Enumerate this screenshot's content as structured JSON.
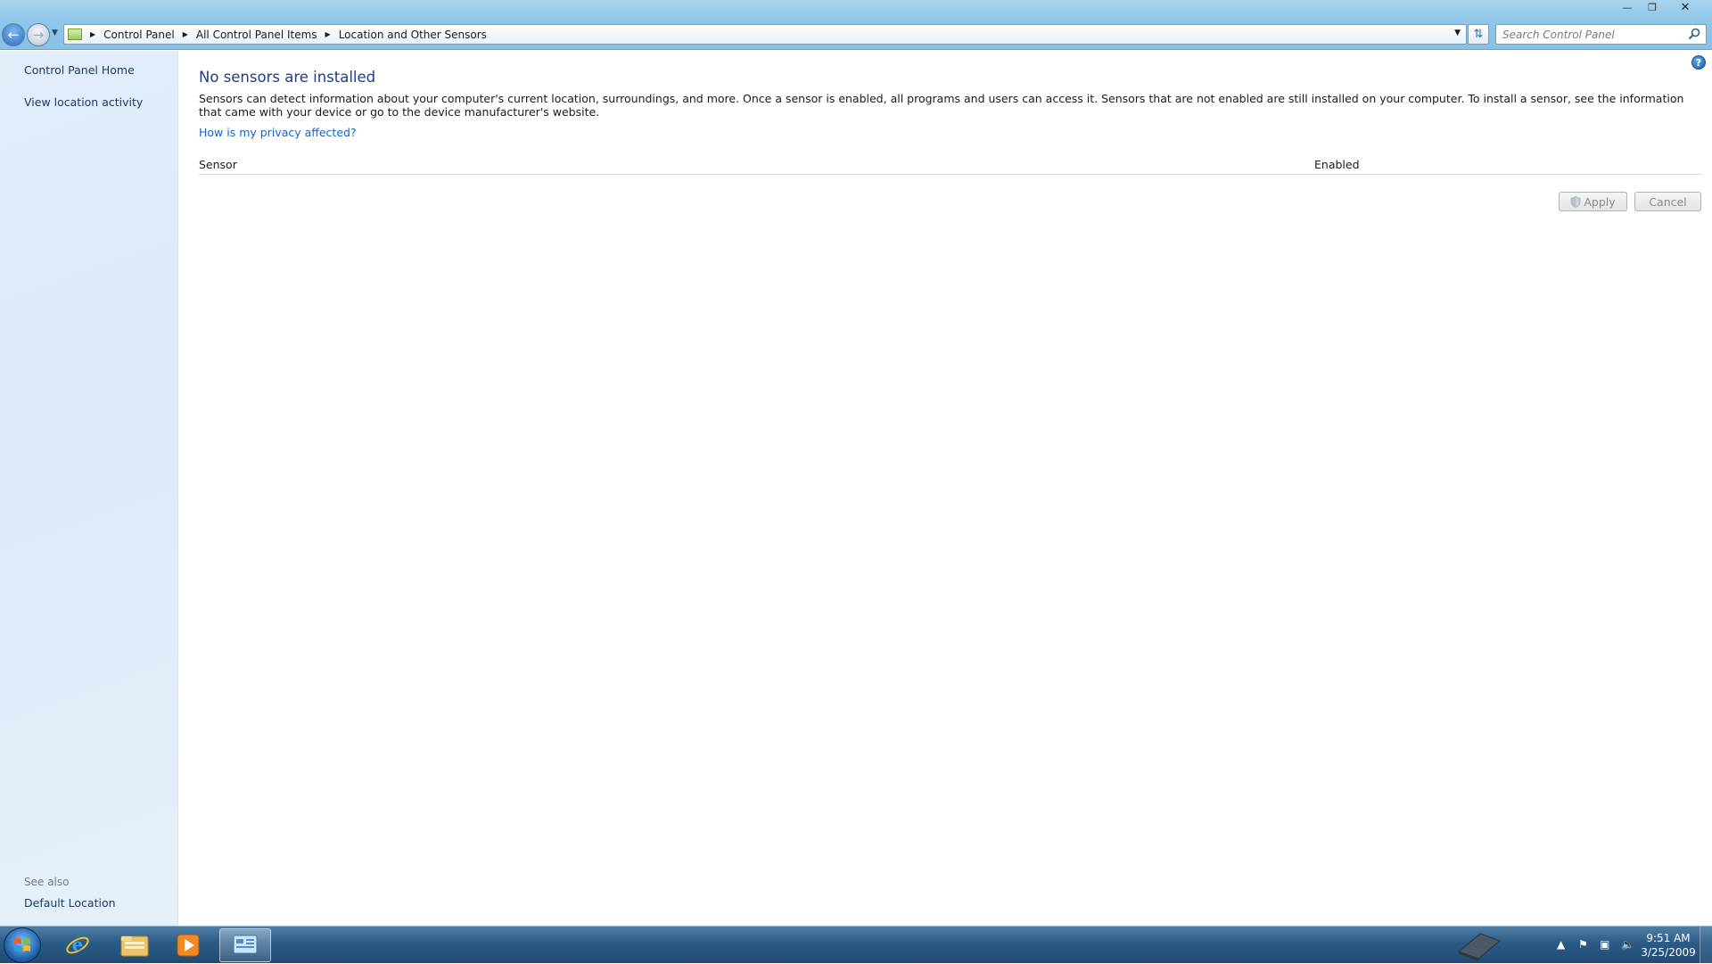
{
  "window": {
    "caption_buttons": [
      "minimize",
      "maximize",
      "close"
    ]
  },
  "navigation": {
    "back_icon": "back-arrow-icon",
    "forward_icon": "forward-arrow-icon"
  },
  "address_bar": {
    "crumbs": [
      "Control Panel",
      "All Control Panel Items",
      "Location and Other Sensors"
    ]
  },
  "search": {
    "placeholder": "Search Control Panel"
  },
  "left_pane": {
    "links": [
      "Control Panel Home",
      "View location activity"
    ],
    "see_also_label": "See also",
    "see_also_links": [
      "Default Location"
    ]
  },
  "main": {
    "title": "No sensors are installed",
    "description": "Sensors can detect information about your computer's current location, surroundings, and more. Once a sensor is enabled, all programs and users can access it. Sensors that are not enabled are still installed on your computer. To install a sensor, see the information that came with your device or go to the device manufacturer's website.",
    "privacy_link": "How is my privacy affected?",
    "table": {
      "columns": [
        "Sensor",
        "Enabled"
      ],
      "rows": []
    },
    "buttons": {
      "apply": "Apply",
      "cancel": "Cancel"
    }
  },
  "taskbar": {
    "pinned": [
      "internet-explorer-icon",
      "windows-explorer-icon",
      "media-player-icon",
      "control-panel-icon"
    ],
    "active": "control-panel-icon",
    "clock": {
      "time": "9:51 AM",
      "date": "3/25/2009"
    }
  },
  "colors": {
    "title_blue": "#1e3c8c",
    "link_blue": "#1565c0",
    "left_pane_bg": "#dbe9f8",
    "taskbar": "#2b5b85"
  }
}
